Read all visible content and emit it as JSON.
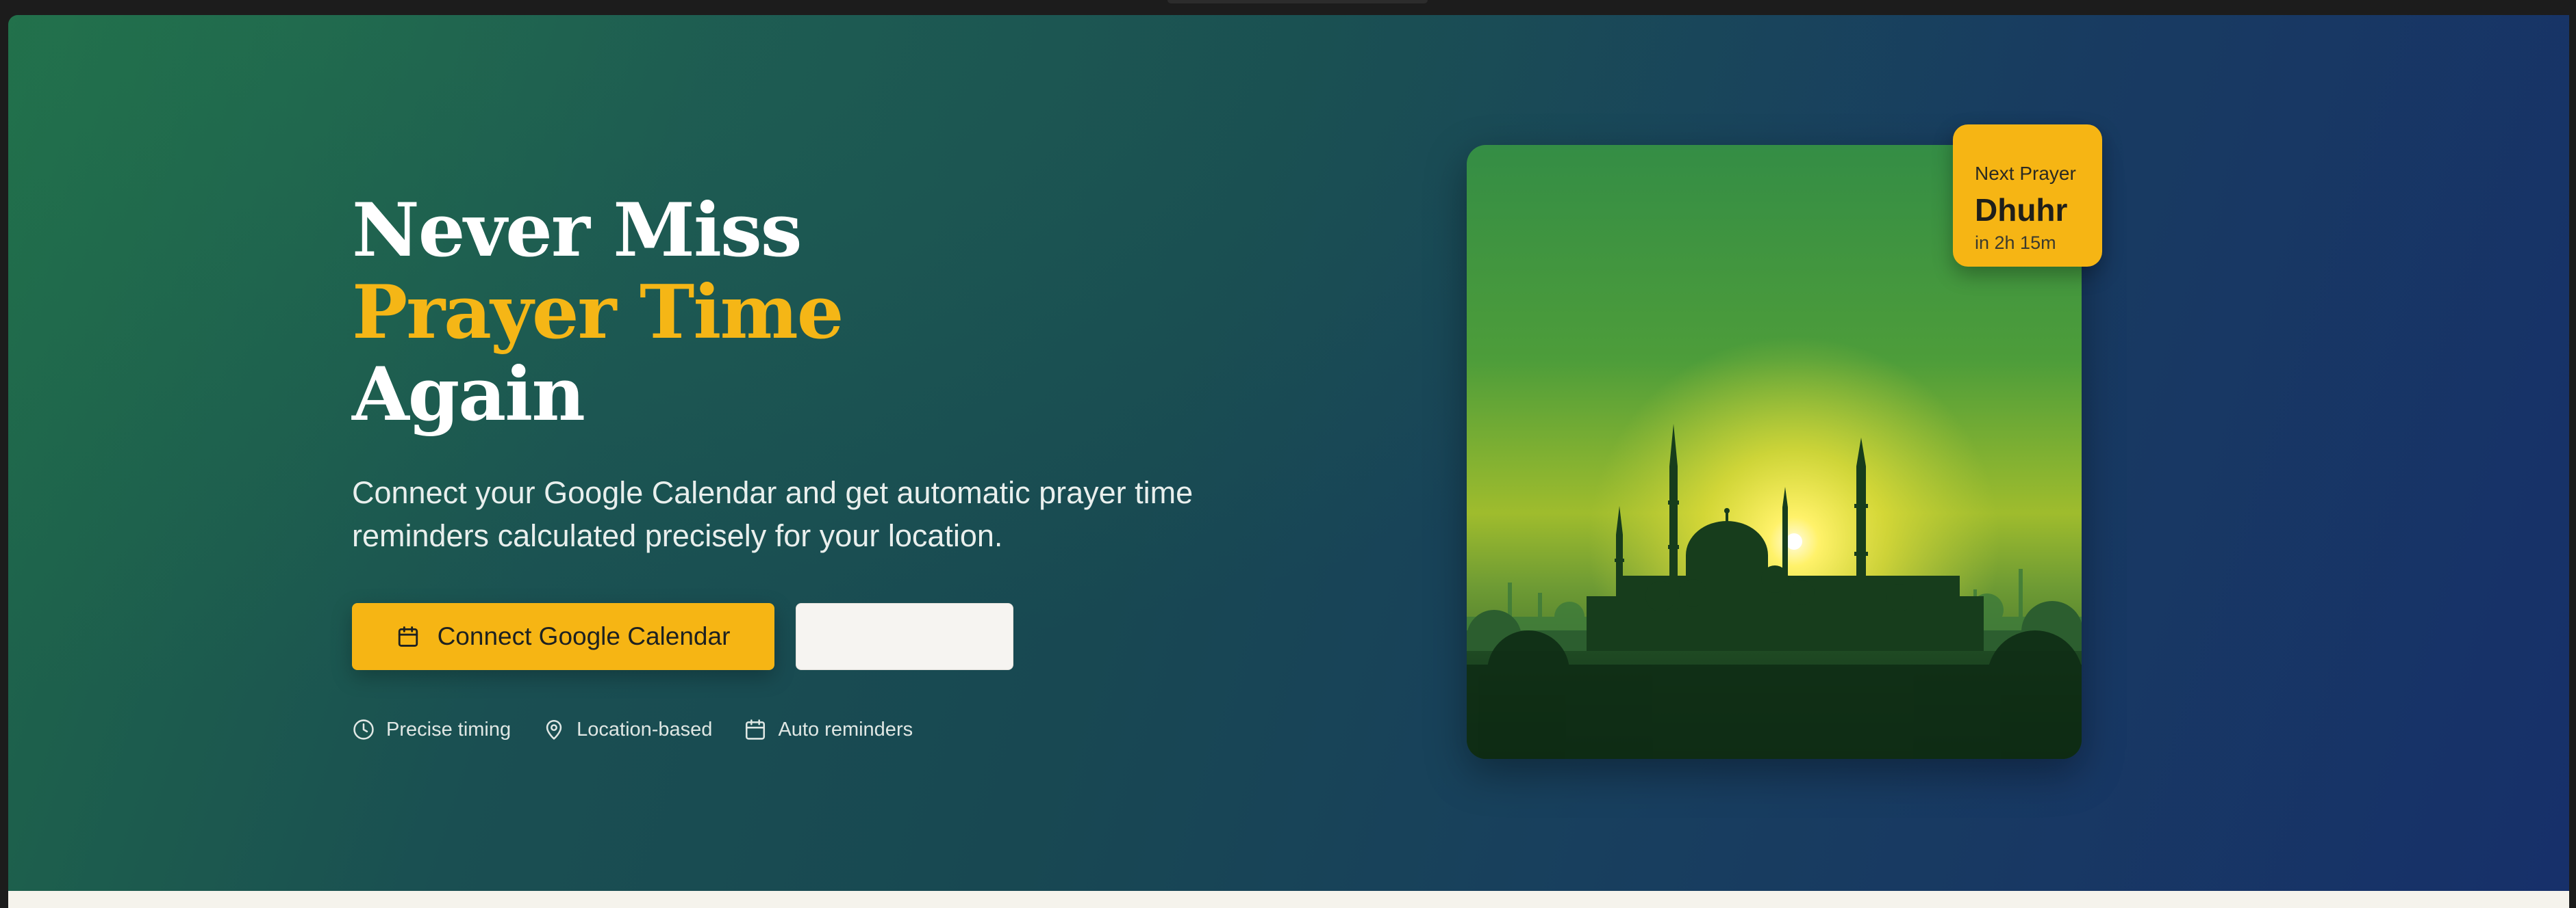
{
  "hero": {
    "title_line1": "Never Miss",
    "title_line2": "Prayer Time",
    "title_line3": "Again",
    "subtitle": "Connect your Google Calendar and get automatic prayer time reminders calculated precisely for your location.",
    "primary_button": {
      "label": "Connect Google Calendar",
      "icon": "calendar-icon"
    },
    "secondary_button": {
      "label": ""
    },
    "features": [
      {
        "icon": "clock-icon",
        "label": "Precise timing"
      },
      {
        "icon": "map-pin-icon",
        "label": "Location-based"
      },
      {
        "icon": "calendar-icon",
        "label": "Auto reminders"
      }
    ]
  },
  "next_prayer": {
    "label": "Next Prayer",
    "name": "Dhuhr",
    "countdown": "in 2h 15m"
  },
  "colors": {
    "accent": "#f6b514",
    "hero_gradient_start": "#1f6a49",
    "hero_gradient_end": "#17306a",
    "title_text": "#ffffff",
    "footer_strip": "#f5f3ec"
  }
}
